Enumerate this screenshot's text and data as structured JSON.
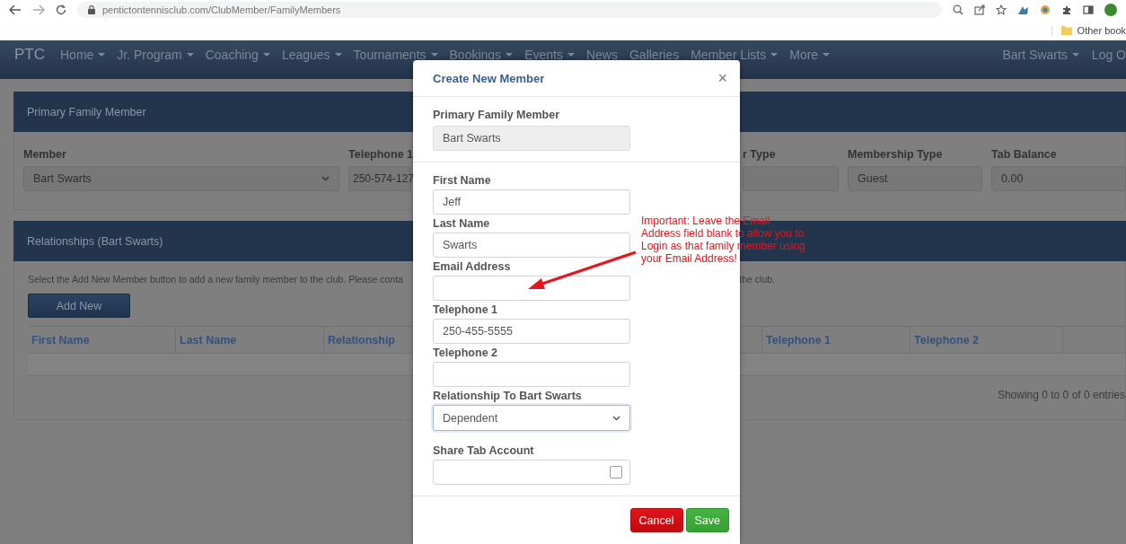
{
  "browser": {
    "url": "pentictontennisclub.com/ClubMember/FamilyMembers",
    "bookmark": "Other book"
  },
  "navbar": {
    "brand": "PTC",
    "items": [
      {
        "label": "Home",
        "dropdown": true
      },
      {
        "label": "Jr. Program",
        "dropdown": true
      },
      {
        "label": "Coaching",
        "dropdown": true
      },
      {
        "label": "Leagues",
        "dropdown": true
      },
      {
        "label": "Tournaments",
        "dropdown": true
      },
      {
        "label": "Bookings",
        "dropdown": true
      },
      {
        "label": "Events",
        "dropdown": true
      },
      {
        "label": "News",
        "dropdown": false
      },
      {
        "label": "Galleries",
        "dropdown": false
      },
      {
        "label": "Member Lists",
        "dropdown": true
      },
      {
        "label": "More",
        "dropdown": true
      }
    ],
    "user": "Bart Swarts",
    "logout": "Log O"
  },
  "primary_panel": {
    "title": "Primary Family Member",
    "fields": [
      {
        "label": "Member",
        "value": "Bart Swarts",
        "kind": "select"
      },
      {
        "label": "Telephone 1",
        "value": "250-574-127",
        "kind": "text"
      },
      {
        "label": "r Type",
        "kind": "text"
      },
      {
        "label": "Membership Type",
        "value": "Guest",
        "kind": "text"
      },
      {
        "label": "Tab Balance",
        "value": "0.00",
        "kind": "text"
      }
    ]
  },
  "relationships_panel": {
    "title": "Relationships (Bart Swarts)",
    "note": "Select the Add New Member button to add a new family member to the club. Please conta",
    "note_end": "the club.",
    "add_button": "Add New",
    "table": {
      "columns": [
        "First Name",
        "Last Name",
        "Relationship",
        "Telephone 1",
        "Telephone 2"
      ]
    },
    "info": "Showing 0 to 0 of 0 entries"
  },
  "modal": {
    "title": "Create New Member",
    "close": "×",
    "primary": {
      "label": "Primary Family Member",
      "value": "Bart Swarts"
    },
    "fields": [
      {
        "label": "First Name",
        "value": "Jeff",
        "kind": "text",
        "focused": false
      },
      {
        "label": "Last Name",
        "value": "Swarts",
        "kind": "text",
        "focused": false
      },
      {
        "label": "Email Address",
        "kind": "text",
        "focused": false
      },
      {
        "label": "Telephone 1",
        "value": "250-455-5555",
        "kind": "text",
        "focused": false
      },
      {
        "label": "Telephone 2",
        "kind": "text",
        "focused": false
      },
      {
        "label": "Relationship To Bart Swarts",
        "value": "Dependent",
        "kind": "select",
        "focused": true
      },
      {
        "label": "Share Tab Account",
        "kind": "checkbox",
        "checked": false,
        "focused": false
      }
    ],
    "buttons": [
      {
        "label": "Cancel",
        "kind": "danger"
      },
      {
        "label": "Save",
        "kind": "success"
      }
    ]
  },
  "annotation": {
    "text": "Important: Leave the Email\nAddress field blank to allow you to\nLogin as that family member using\nyour Email Address!"
  }
}
